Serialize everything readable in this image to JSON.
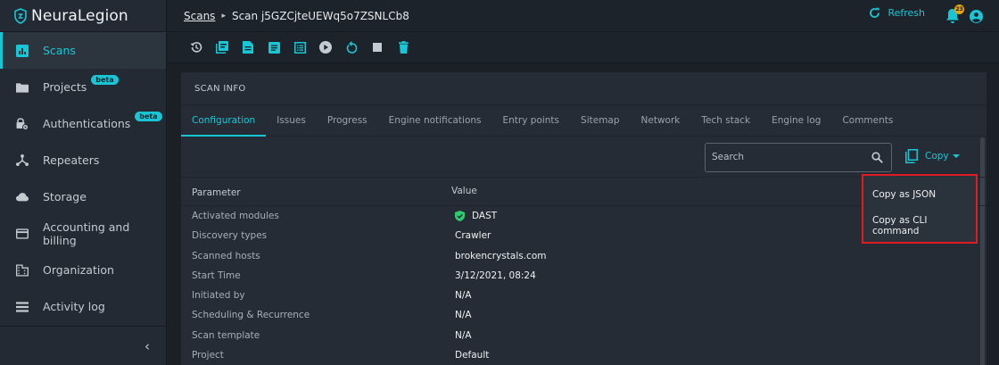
{
  "brand": {
    "name": "NeuraLegion"
  },
  "sidebar": {
    "items": [
      {
        "label": "Scans",
        "icon": "bar-chart-icon",
        "active": true
      },
      {
        "label": "Projects",
        "icon": "folder-icon",
        "badge": "beta"
      },
      {
        "label": "Authentications",
        "icon": "lock-gear-icon",
        "badge": "beta"
      },
      {
        "label": "Repeaters",
        "icon": "hub-icon"
      },
      {
        "label": "Storage",
        "icon": "cloud-icon"
      },
      {
        "label": "Accounting and billing",
        "icon": "credit-card-icon"
      },
      {
        "label": "Organization",
        "icon": "building-icon"
      },
      {
        "label": "Activity log",
        "icon": "list-icon"
      }
    ],
    "collapse_glyph": "‹"
  },
  "header": {
    "breadcrumb_link": "Scans",
    "breadcrumb_sep": "▸",
    "breadcrumb_current": "Scan j5GZCjteUEWq5o7ZSNLCb8",
    "refresh_label": "Refresh",
    "notification_count": "23"
  },
  "toolbar": {
    "buttons": [
      "history-icon",
      "pdf-icon",
      "document-icon",
      "report-icon",
      "list-alt-icon",
      "play-icon",
      "retry-icon",
      "stop-icon",
      "delete-icon"
    ]
  },
  "card": {
    "title": "SCAN INFO",
    "tabs": [
      "Configuration",
      "Issues",
      "Progress",
      "Engine notifications",
      "Entry points",
      "Sitemap",
      "Network",
      "Tech stack",
      "Engine log",
      "Comments"
    ],
    "active_tab": "Configuration",
    "search_placeholder": "Search",
    "copy_label": "Copy",
    "columns": {
      "param": "Parameter",
      "value": "Value"
    },
    "rows": [
      {
        "param": "Activated modules",
        "value": "DAST"
      },
      {
        "param": "Discovery types",
        "value": "Crawler"
      },
      {
        "param": "Scanned hosts",
        "value": "brokencrystals.com"
      },
      {
        "param": "Start Time",
        "value": "3/12/2021, 08:24"
      },
      {
        "param": "Initiated by",
        "value": "N/A"
      },
      {
        "param": "Scheduling & Recurrence",
        "value": "N/A"
      },
      {
        "param": "Scan template",
        "value": "N/A"
      },
      {
        "param": "Project",
        "value": "Default"
      }
    ]
  },
  "copy_menu": {
    "items": [
      "Copy as JSON",
      "Copy as CLI command"
    ],
    "highlight_color": "#e01b24"
  },
  "colors": {
    "accent": "#18c7d6",
    "background": "#1b2027",
    "surface": "#252c35"
  }
}
